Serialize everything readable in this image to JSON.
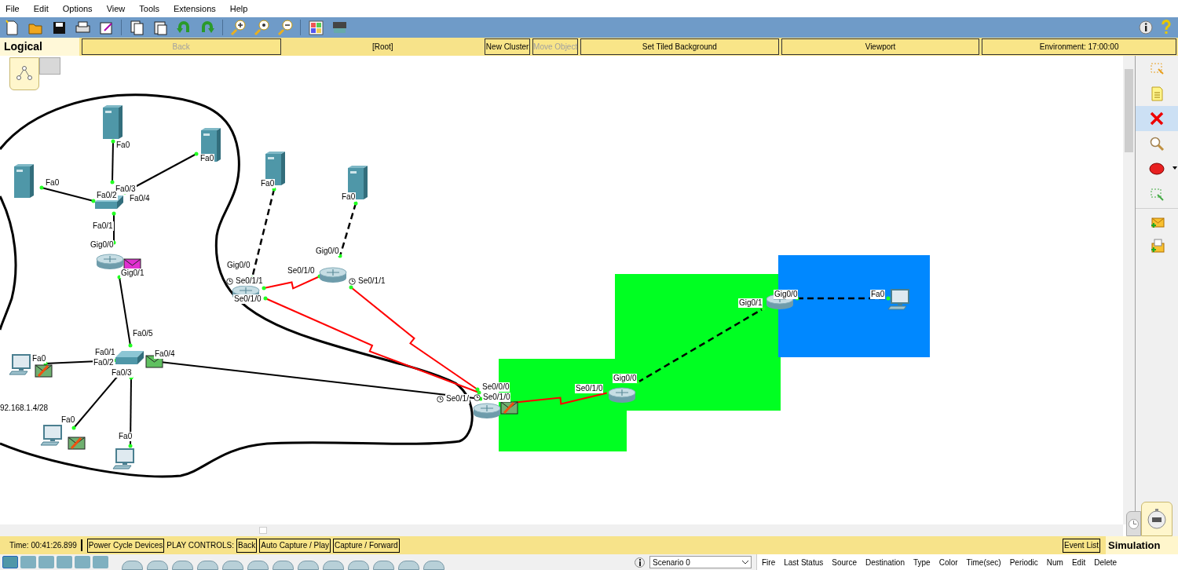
{
  "menu": [
    "File",
    "Edit",
    "Options",
    "View",
    "Tools",
    "Extensions",
    "Help"
  ],
  "workspace_bar": {
    "mode": "Logical",
    "controls": [
      {
        "kind": "button",
        "label": "Back",
        "disabled": true
      },
      {
        "kind": "label",
        "label": "[Root]"
      },
      {
        "kind": "button",
        "label": "New Cluster",
        "disabled": false
      },
      {
        "kind": "button",
        "label": "Move Object",
        "disabled": true
      },
      {
        "kind": "button",
        "label": "Set Tiled Background",
        "disabled": false
      },
      {
        "kind": "button",
        "label": "Viewport",
        "disabled": false
      },
      {
        "kind": "button",
        "label": "Environment: 17:00:00",
        "disabled": false
      }
    ]
  },
  "canvas": {
    "areas": [
      {
        "color": "#00ff22"
      },
      {
        "color": "#00ff22"
      },
      {
        "color": "#0088ff"
      }
    ],
    "devices": [
      {
        "kind": "server"
      },
      {
        "kind": "server"
      },
      {
        "kind": "server"
      },
      {
        "kind": "switch"
      },
      {
        "kind": "router",
        "pdu": {
          "color": "#e030d0",
          "failed": false
        }
      },
      {
        "kind": "switch",
        "pdu": {
          "color": "#60c060",
          "failed": false
        }
      },
      {
        "kind": "pc",
        "pdu": {
          "color": "#70b070",
          "failed": true
        }
      },
      {
        "kind": "pc",
        "pdu": {
          "color": "#70b070",
          "failed": true
        }
      },
      {
        "kind": "pc"
      },
      {
        "kind": "server"
      },
      {
        "kind": "server"
      },
      {
        "kind": "router"
      },
      {
        "kind": "router"
      },
      {
        "kind": "router",
        "pdu": {
          "color": "#70b070",
          "failed": true
        }
      },
      {
        "kind": "router"
      },
      {
        "kind": "router"
      },
      {
        "kind": "pc"
      }
    ],
    "links": [
      {
        "kind": "copper"
      },
      {
        "kind": "copper"
      },
      {
        "kind": "copper"
      },
      {
        "kind": "copper"
      },
      {
        "kind": "copper"
      },
      {
        "kind": "copper"
      },
      {
        "kind": "copper"
      },
      {
        "kind": "copper"
      },
      {
        "kind": "copper"
      },
      {
        "kind": "crossover"
      },
      {
        "kind": "crossover"
      },
      {
        "kind": "crossover"
      },
      {
        "kind": "crossover"
      },
      {
        "kind": "serial"
      },
      {
        "kind": "serial"
      },
      {
        "kind": "serial"
      },
      {
        "kind": "serial"
      }
    ],
    "port_labels": [
      {
        "text": "Fa0",
        "clock": false
      },
      {
        "text": "Fa0",
        "clock": false
      },
      {
        "text": "Fa0",
        "clock": false
      },
      {
        "text": "Fa0/3",
        "clock": false
      },
      {
        "text": "Fa0/2",
        "clock": false
      },
      {
        "text": "Fa0/4",
        "clock": false
      },
      {
        "text": "Fa0/1",
        "clock": false
      },
      {
        "text": "Gig0/0",
        "clock": false
      },
      {
        "text": "Gig0/1",
        "clock": false
      },
      {
        "text": "Fa0",
        "clock": false
      },
      {
        "text": "Fa0",
        "clock": false
      },
      {
        "text": "Gig0/0",
        "clock": false
      },
      {
        "text": "Gig0/0",
        "clock": false
      },
      {
        "text": "Se0/1/0",
        "clock": false
      },
      {
        "text": "Se0/1/1",
        "clock": true
      },
      {
        "text": "Se0/1/0",
        "clock": false
      },
      {
        "text": "Se0/1/1",
        "clock": true
      },
      {
        "text": "Fa0/5",
        "clock": false
      },
      {
        "text": "Fa0/1",
        "clock": false
      },
      {
        "text": "Fa0/4",
        "clock": false
      },
      {
        "text": "Fa0/2",
        "clock": false
      },
      {
        "text": "Fa0/3",
        "clock": false
      },
      {
        "text": "Fa0",
        "clock": false
      },
      {
        "text": "Fa0",
        "clock": false
      },
      {
        "text": "Fa0",
        "clock": false
      },
      {
        "text": "Se0/1/",
        "clock": true
      },
      {
        "text": "Se0/0/0",
        "clock": false
      },
      {
        "text": "Se0/1/0",
        "clock": true
      },
      {
        "text": "Se0/1/0",
        "clock": false
      },
      {
        "text": "Gig0/0",
        "clock": false
      },
      {
        "text": "Gig0/1",
        "clock": false
      },
      {
        "text": "Gig0/0",
        "clock": false
      },
      {
        "text": "Fa0",
        "clock": false
      }
    ],
    "annotation": "92.168.1.4/28"
  },
  "palette": [
    {
      "kind": "select",
      "selected": false
    },
    {
      "kind": "note",
      "selected": false
    },
    {
      "kind": "delete",
      "selected": true
    },
    {
      "kind": "inspect",
      "selected": false
    },
    {
      "kind": "ellipse",
      "selected": false
    },
    {
      "kind": "resize",
      "selected": false
    },
    {
      "kind": "simple_pdu",
      "selected": false
    },
    {
      "kind": "complex_pdu",
      "selected": false
    }
  ],
  "simulation_bar": {
    "time": "Time: 00:41:26.899",
    "controls": [
      {
        "kind": "button",
        "label": "Power Cycle Devices"
      },
      {
        "kind": "label",
        "label": "PLAY CONTROLS:"
      },
      {
        "kind": "button",
        "label": "Back"
      },
      {
        "kind": "button",
        "label": "Auto Capture / Play"
      },
      {
        "kind": "button",
        "label": "Capture / Forward"
      }
    ],
    "event_list": "Event List",
    "mode": "Simulation"
  },
  "scenario": {
    "value": "Scenario 0"
  },
  "pdu_table": {
    "columns": [
      "Fire",
      "Last Status",
      "Source",
      "Destination",
      "Type",
      "Color",
      "Time(sec)",
      "Periodic",
      "Num",
      "Edit",
      "Delete"
    ]
  }
}
